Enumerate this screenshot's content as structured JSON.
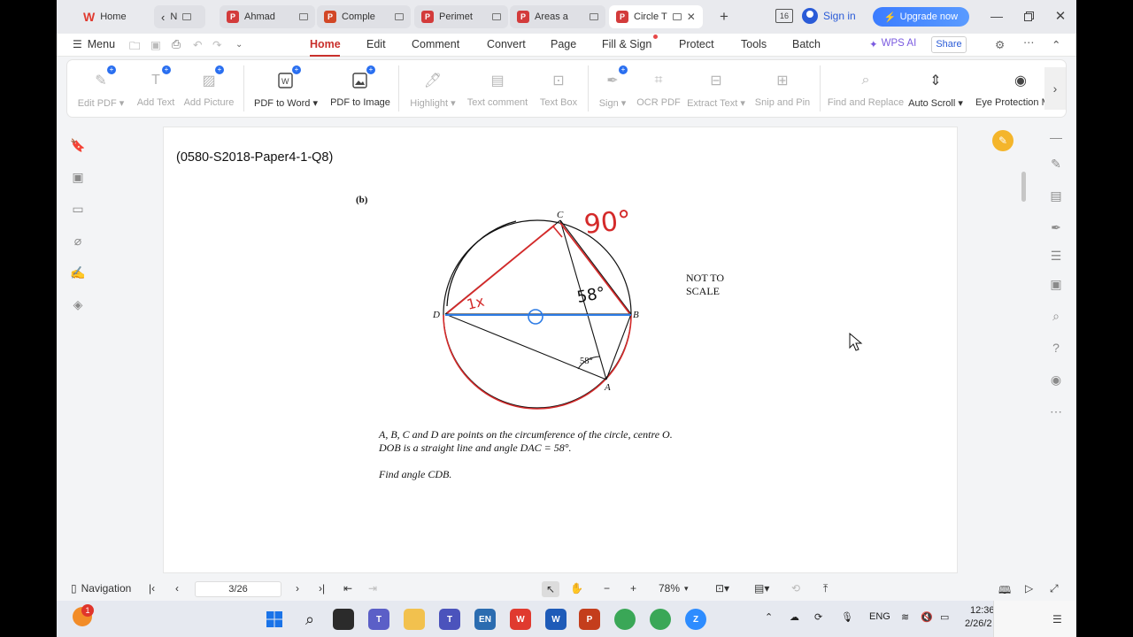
{
  "tabs": [
    {
      "label": "Home",
      "kind": "wps"
    },
    {
      "label": "N",
      "kind": "back"
    },
    {
      "label": "Ahmad",
      "kind": "pdf"
    },
    {
      "label": "Comple",
      "kind": "ppt"
    },
    {
      "label": "Perimet",
      "kind": "pdf"
    },
    {
      "label": "Areas a",
      "kind": "pdf"
    },
    {
      "label": "Circle T",
      "kind": "pdf",
      "active": true
    }
  ],
  "titlebar": {
    "sign_in": "Sign in",
    "upgrade": "Upgrade now",
    "counter": "16"
  },
  "menu": {
    "menu_label": "Menu",
    "items": [
      "Home",
      "Edit",
      "Comment",
      "Convert",
      "Page",
      "Fill & Sign",
      "Protect",
      "Tools",
      "Batch"
    ],
    "wps_ai": "WPS AI",
    "share": "Share"
  },
  "ribbon": {
    "edit_pdf": "Edit PDF",
    "add_text": "Add Text",
    "add_picture": "Add Picture",
    "pdf_to_word": "PDF to Word",
    "pdf_to_image": "PDF to Image",
    "highlight": "Highlight",
    "text_comment": "Text comment",
    "text_box": "Text Box",
    "sign": "Sign",
    "ocr_pdf": "OCR PDF",
    "extract_text": "Extract Text",
    "snip_and_pin": "Snip and Pin",
    "find_and_replace": "Find and Replace",
    "auto_scroll": "Auto Scroll",
    "eye_protection": "Eye Protection M"
  },
  "document": {
    "ref": "(0580-S2018-Paper4-1-Q8)",
    "part": "(b)",
    "not_to_scale_1": "NOT TO",
    "not_to_scale_2": "SCALE",
    "label_c": "C",
    "label_d": "D",
    "label_b": "B",
    "label_a": "A",
    "angle_58": "58°",
    "hand_90": "90°",
    "hand_58": "58°",
    "hand_1x": "1x",
    "q_line1": "A, B, C and D are points on the circumference of the circle, centre O.",
    "q_line2": "DOB is a straight line and angle DAC = 58°.",
    "q_line3": "Find angle CDB."
  },
  "status": {
    "navigation": "Navigation",
    "page": "3/26",
    "zoom": "78%"
  },
  "taskbar": {
    "lang": "ENG",
    "time": "12:36",
    "date": "2/26/2",
    "notification_count": "1"
  },
  "colors": {
    "accent_red": "#c9302c",
    "upgrade_blue": "#3b7cff",
    "pen_red": "#d42a2a",
    "pen_blue": "#2c7be5"
  }
}
